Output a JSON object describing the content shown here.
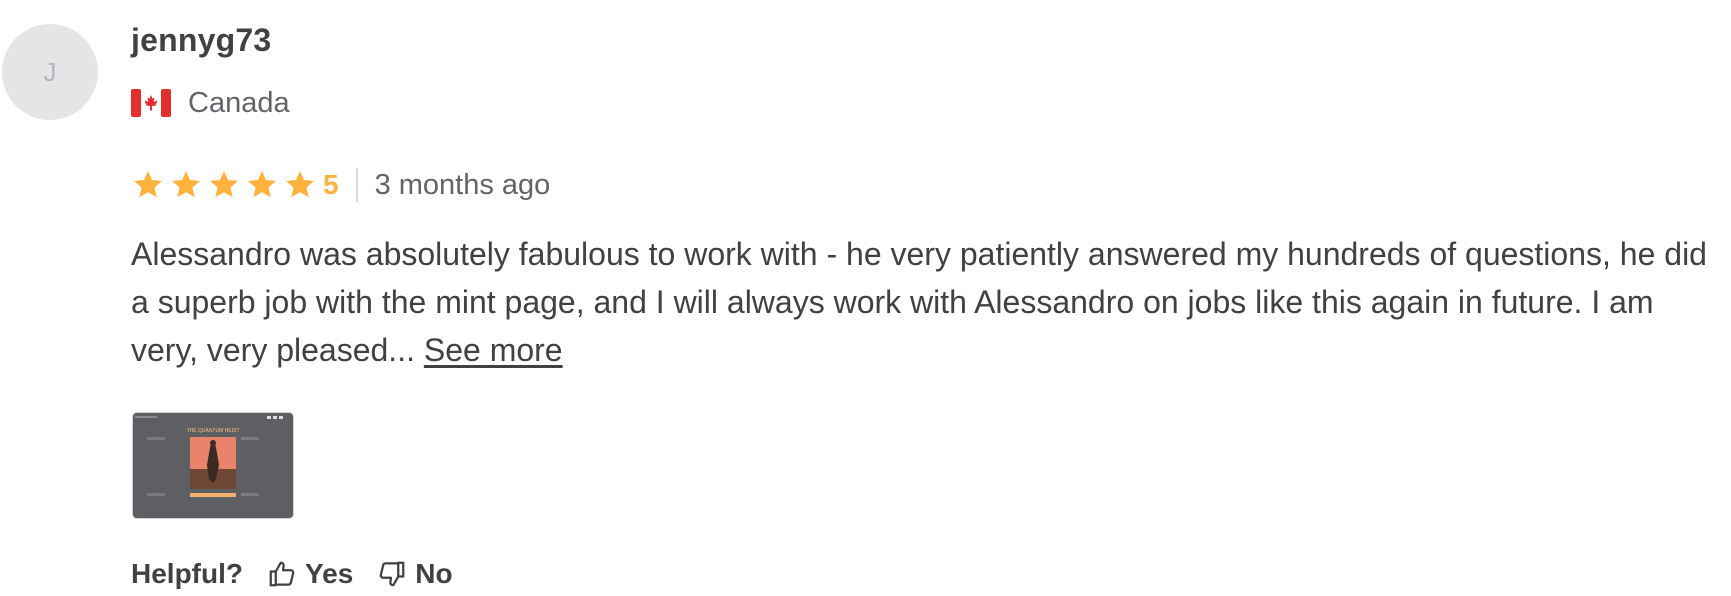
{
  "reviewer": {
    "avatar_initial": "J",
    "username": "jennyg73",
    "country": "Canada",
    "flag_icon": "canada-flag-icon"
  },
  "rating": {
    "stars": 5,
    "value": "5",
    "time_ago": "3 months ago",
    "star_color": "#ffb33e"
  },
  "review": {
    "text": "Alessandro was absolutely fabulous to work with - he very patiently answered my hundreds of questions, he did a superb job with the mint page, and I will always work with Alessandro on jobs like this again in future. I am very, very pleased...",
    "see_more_label": "See more"
  },
  "attachment": {
    "title": "THE QUANTUM HEIST"
  },
  "helpful": {
    "label": "Helpful?",
    "yes_label": "Yes",
    "no_label": "No"
  }
}
